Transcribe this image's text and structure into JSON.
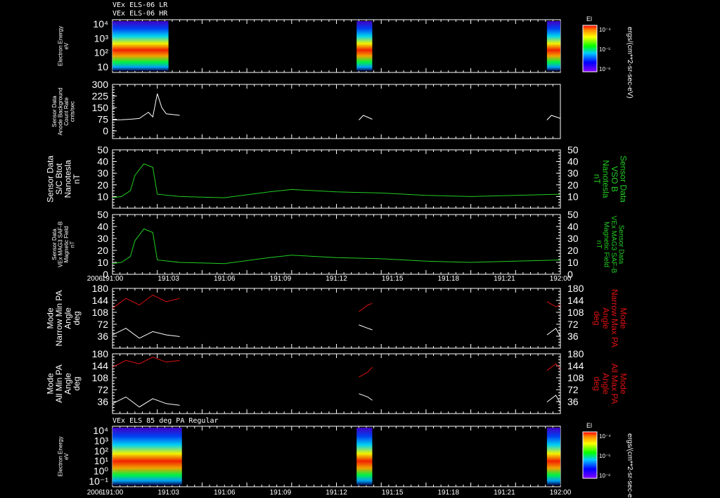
{
  "header": {
    "line1": "VEx ELS-06 LR",
    "line2": "VEx ELS-06 HR",
    "panel7_title": "VEx ELS 85 deg PA Regular"
  },
  "colors": {
    "background": "#000000",
    "frame": "#ffffff",
    "green_trace": "#22cc22",
    "red_trace": "#dd1111",
    "white_trace": "#ffffff"
  },
  "colorbar": {
    "label": "El",
    "units": "ergs/(cm**2-sr-sec-eV)",
    "ticks": [
      "10⁻⁴",
      "10⁻⁵",
      "10⁻⁶"
    ]
  },
  "x_axis": {
    "year_label": "2006",
    "ticks": [
      "191:00",
      "191:03",
      "191:06",
      "191:09",
      "191:12",
      "191:15",
      "191:18",
      "191:21",
      "192:00"
    ]
  },
  "chart_data": [
    {
      "type": "heatmap",
      "ylabel": [
        "Electron Energy",
        "eV"
      ],
      "y_ticks": [
        "10⁴",
        "10³",
        "10²",
        "10"
      ],
      "y_scale": "log",
      "data_segments": [
        [
          0.0,
          0.125
        ],
        [
          0.545,
          0.58
        ],
        [
          0.97,
          1.0
        ]
      ]
    },
    {
      "type": "line",
      "ylabel": [
        "Sensor Data",
        "Anode Background",
        "Count Rate",
        "cnts/sec"
      ],
      "ylim": [
        -50,
        300
      ],
      "y_ticks": [
        "300",
        "225",
        "150",
        "75",
        "0"
      ],
      "series": [
        {
          "color": "white",
          "points": [
            [
              0.0,
              70
            ],
            [
              0.02,
              72
            ],
            [
              0.04,
              75
            ],
            [
              0.06,
              80
            ],
            [
              0.08,
              120
            ],
            [
              0.09,
              90
            ],
            [
              0.1,
              240
            ],
            [
              0.11,
              150
            ],
            [
              0.12,
              110
            ],
            [
              0.15,
              100
            ]
          ]
        },
        {
          "color": "white",
          "points": [
            [
              0.55,
              70
            ],
            [
              0.56,
              100
            ],
            [
              0.58,
              75
            ]
          ]
        },
        {
          "color": "white",
          "points": [
            [
              0.97,
              70
            ],
            [
              0.98,
              100
            ],
            [
              1.0,
              80
            ]
          ]
        }
      ]
    },
    {
      "type": "line",
      "ylabel": [
        "Sensor Data",
        "S/C Btot",
        "Nanotesla",
        "nT"
      ],
      "ylabel_right": [
        "Sensor Data",
        "VSO B",
        "Nanotesla",
        "nT"
      ],
      "ylim": [
        0,
        50
      ],
      "y_ticks": [
        "50",
        "40",
        "30",
        "20",
        "10"
      ],
      "series": [
        {
          "color": "green",
          "points": [
            [
              0.0,
              9
            ],
            [
              0.02,
              10
            ],
            [
              0.04,
              15
            ],
            [
              0.05,
              28
            ],
            [
              0.07,
              38
            ],
            [
              0.09,
              35
            ],
            [
              0.1,
              12
            ],
            [
              0.15,
              10
            ],
            [
              0.25,
              9
            ],
            [
              0.35,
              14
            ],
            [
              0.4,
              16
            ],
            [
              0.5,
              14
            ],
            [
              0.6,
              13
            ],
            [
              0.7,
              11
            ],
            [
              0.8,
              10
            ],
            [
              0.9,
              11
            ],
            [
              1.0,
              12
            ]
          ]
        }
      ]
    },
    {
      "type": "line",
      "ylabel": [
        "Sensor Data",
        "VEx MAG3 SAF-B",
        "Magnetic Field",
        "nT"
      ],
      "ylabel_right": [
        "Sensor Data",
        "VEx MAG3 SAF-B",
        "Magnetic Field",
        "nT"
      ],
      "ylim": [
        0,
        50
      ],
      "y_ticks": [
        "50",
        "40",
        "30",
        "20",
        "10",
        "0"
      ],
      "series": [
        {
          "color": "green",
          "points": [
            [
              0.0,
              9
            ],
            [
              0.02,
              10
            ],
            [
              0.04,
              15
            ],
            [
              0.05,
              28
            ],
            [
              0.07,
              38
            ],
            [
              0.09,
              35
            ],
            [
              0.1,
              12
            ],
            [
              0.15,
              10
            ],
            [
              0.25,
              9
            ],
            [
              0.35,
              14
            ],
            [
              0.4,
              16
            ],
            [
              0.5,
              14
            ],
            [
              0.6,
              13
            ],
            [
              0.7,
              11
            ],
            [
              0.8,
              10
            ],
            [
              0.9,
              11
            ],
            [
              1.0,
              12
            ]
          ]
        }
      ]
    },
    {
      "type": "line",
      "ylabel": [
        "Mode",
        "Narrow Min PA",
        "Angle",
        "deg"
      ],
      "ylabel_right": [
        "Mode",
        "Narrow Max PA",
        "Angle",
        "deg"
      ],
      "ylim": [
        0,
        180
      ],
      "y_ticks": [
        "180",
        "144",
        "108",
        "72",
        "36"
      ],
      "series": [
        {
          "color": "red",
          "points": [
            [
              0.0,
              120
            ],
            [
              0.03,
              150
            ],
            [
              0.06,
              130
            ],
            [
              0.09,
              160
            ],
            [
              0.12,
              140
            ],
            [
              0.15,
              150
            ]
          ]
        },
        {
          "color": "white",
          "points": [
            [
              0.0,
              40
            ],
            [
              0.03,
              60
            ],
            [
              0.06,
              30
            ],
            [
              0.09,
              50
            ],
            [
              0.12,
              40
            ],
            [
              0.15,
              35
            ]
          ]
        },
        {
          "color": "red",
          "points": [
            [
              0.55,
              110
            ],
            [
              0.57,
              130
            ],
            [
              0.58,
              135
            ]
          ]
        },
        {
          "color": "white",
          "points": [
            [
              0.55,
              70
            ],
            [
              0.57,
              60
            ],
            [
              0.58,
              55
            ]
          ]
        },
        {
          "color": "red",
          "points": [
            [
              0.97,
              140
            ],
            [
              0.99,
              125
            ],
            [
              1.0,
              130
            ]
          ]
        },
        {
          "color": "white",
          "points": [
            [
              0.97,
              40
            ],
            [
              0.99,
              60
            ],
            [
              1.0,
              35
            ]
          ]
        }
      ]
    },
    {
      "type": "line",
      "ylabel": [
        "Mode",
        "All Min PA",
        "Angle",
        "deg"
      ],
      "ylabel_right": [
        "Mode",
        "All Max PA",
        "Angle",
        "deg"
      ],
      "ylim": [
        0,
        180
      ],
      "y_ticks": [
        "180",
        "144",
        "108",
        "72",
        "36"
      ],
      "series": [
        {
          "color": "red",
          "points": [
            [
              0.0,
              140
            ],
            [
              0.03,
              160
            ],
            [
              0.06,
              150
            ],
            [
              0.09,
              170
            ],
            [
              0.12,
              155
            ],
            [
              0.15,
              160
            ]
          ]
        },
        {
          "color": "white",
          "points": [
            [
              0.0,
              30
            ],
            [
              0.03,
              50
            ],
            [
              0.06,
              20
            ],
            [
              0.09,
              45
            ],
            [
              0.12,
              30
            ],
            [
              0.15,
              25
            ]
          ]
        },
        {
          "color": "red",
          "points": [
            [
              0.55,
              110
            ],
            [
              0.57,
              125
            ],
            [
              0.58,
              140
            ]
          ]
        },
        {
          "color": "white",
          "points": [
            [
              0.55,
              60
            ],
            [
              0.57,
              50
            ],
            [
              0.58,
              40
            ]
          ]
        },
        {
          "color": "red",
          "points": [
            [
              0.97,
              130
            ],
            [
              0.99,
              150
            ],
            [
              1.0,
              135
            ]
          ]
        },
        {
          "color": "white",
          "points": [
            [
              0.97,
              35
            ],
            [
              0.99,
              55
            ],
            [
              1.0,
              30
            ]
          ]
        }
      ]
    },
    {
      "type": "heatmap",
      "ylabel": [
        "Electron Energy",
        "eV"
      ],
      "y_ticks": [
        "10⁴",
        "10³",
        "10²",
        "10¹",
        "10⁰",
        "10⁻¹"
      ],
      "y_scale": "log",
      "data_segments": [
        [
          0.0,
          0.155
        ],
        [
          0.545,
          0.58
        ],
        [
          0.97,
          1.0
        ]
      ]
    }
  ]
}
